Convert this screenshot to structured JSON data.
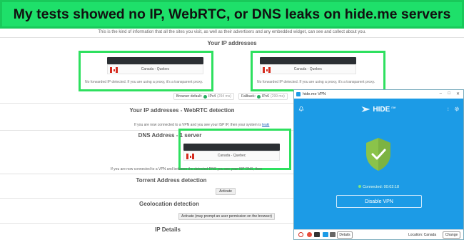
{
  "banner": {
    "text": "My tests showed no IP, WebRTC, or DNS leaks on hide.me servers"
  },
  "page": {
    "intro": "This is the kind of information that all the sites you visit, as well as their advertisers and any embedded widget, can see and collect about you.",
    "ip_section_title": "Your IP addresses",
    "ip_cards": [
      {
        "location": "Canada - Quebec",
        "note": "No forwarded IP detected. If you are using a proxy, it's a transparent proxy."
      },
      {
        "location": "Canada - Quebec",
        "note": "No forwarded IP detected. If you are using a proxy, it's a transparent proxy."
      }
    ],
    "browser_default_label": "Browser default:",
    "browser_default_value": "IPv4",
    "browser_default_ms": "(294 ms)",
    "fallback_label": "Fallback:",
    "fallback_value": "IPv6",
    "fallback_ms": "(299 ms)",
    "webrtc_title": "Your IP addresses - WebRTC detection",
    "webrtc_note": "If you are now connected to a VPN and you see your ISP IP, then your system is",
    "webrtc_note_link": "leaki",
    "dns_title": "DNS Address - 1 server",
    "dns_location": "Canada - Quebec",
    "dns_note": "If you are now connected to a VPN and between the detected DNS you see your ISP DNS, then",
    "torrent_title": "Torrent Address detection",
    "torrent_button": "Activate",
    "geo_title": "Geolocation detection",
    "geo_button": "Activate (may prompt an user permission on the browser)",
    "ip_details_title": "IP Details"
  },
  "vpn": {
    "window_title": "hide.me VPN",
    "brand": "HIDE",
    "brand_suffix": "me",
    "status_text": "Connected: 00:02:18",
    "disable_button": "Disable VPN",
    "details_button": "Details",
    "location_label": "Location: Canada",
    "change_button": "Change",
    "colors": {
      "background": "#1c9be6",
      "shield": "#8bc34a"
    }
  }
}
